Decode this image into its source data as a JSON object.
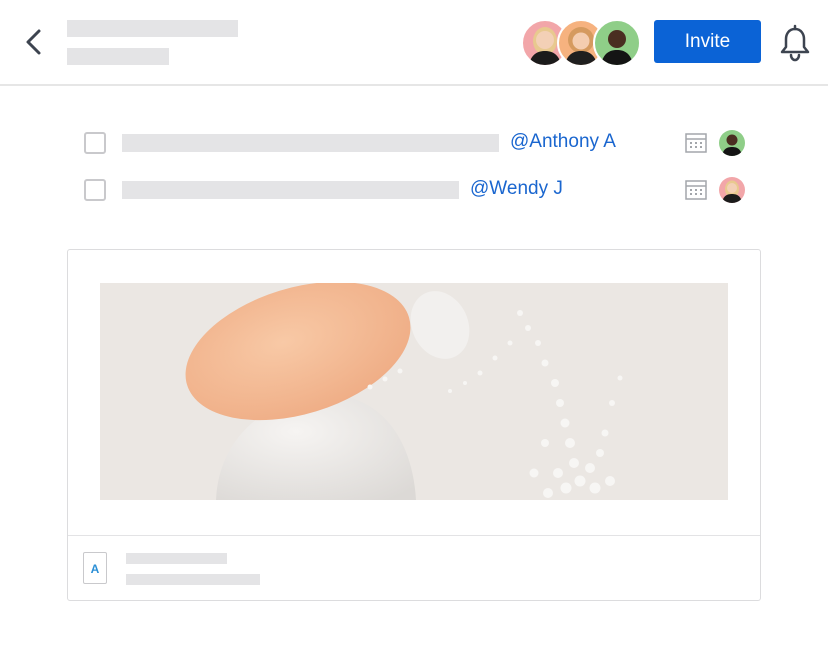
{
  "header": {
    "invite_label": "Invite",
    "icons": [
      "chevron-left-icon",
      "bell-icon"
    ],
    "collaborators": [
      "avatar-woman-blonde",
      "avatar-woman-curly",
      "avatar-man"
    ]
  },
  "tasks": [
    {
      "mention": "@Anthony A",
      "icon": "calendar-icon",
      "assignee": "avatar-man"
    },
    {
      "mention": "@Wendy J",
      "icon": "calendar-icon",
      "assignee": "avatar-woman-blonde"
    }
  ],
  "file_card": {
    "preview": "abstract-sculpture-image",
    "icon": "file-icon",
    "glyph": "A"
  },
  "colors": {
    "accent": "#0b63d6",
    "mention": "#1a66cf",
    "skeleton": "#e4e4e6",
    "border": "#dcdcde"
  }
}
